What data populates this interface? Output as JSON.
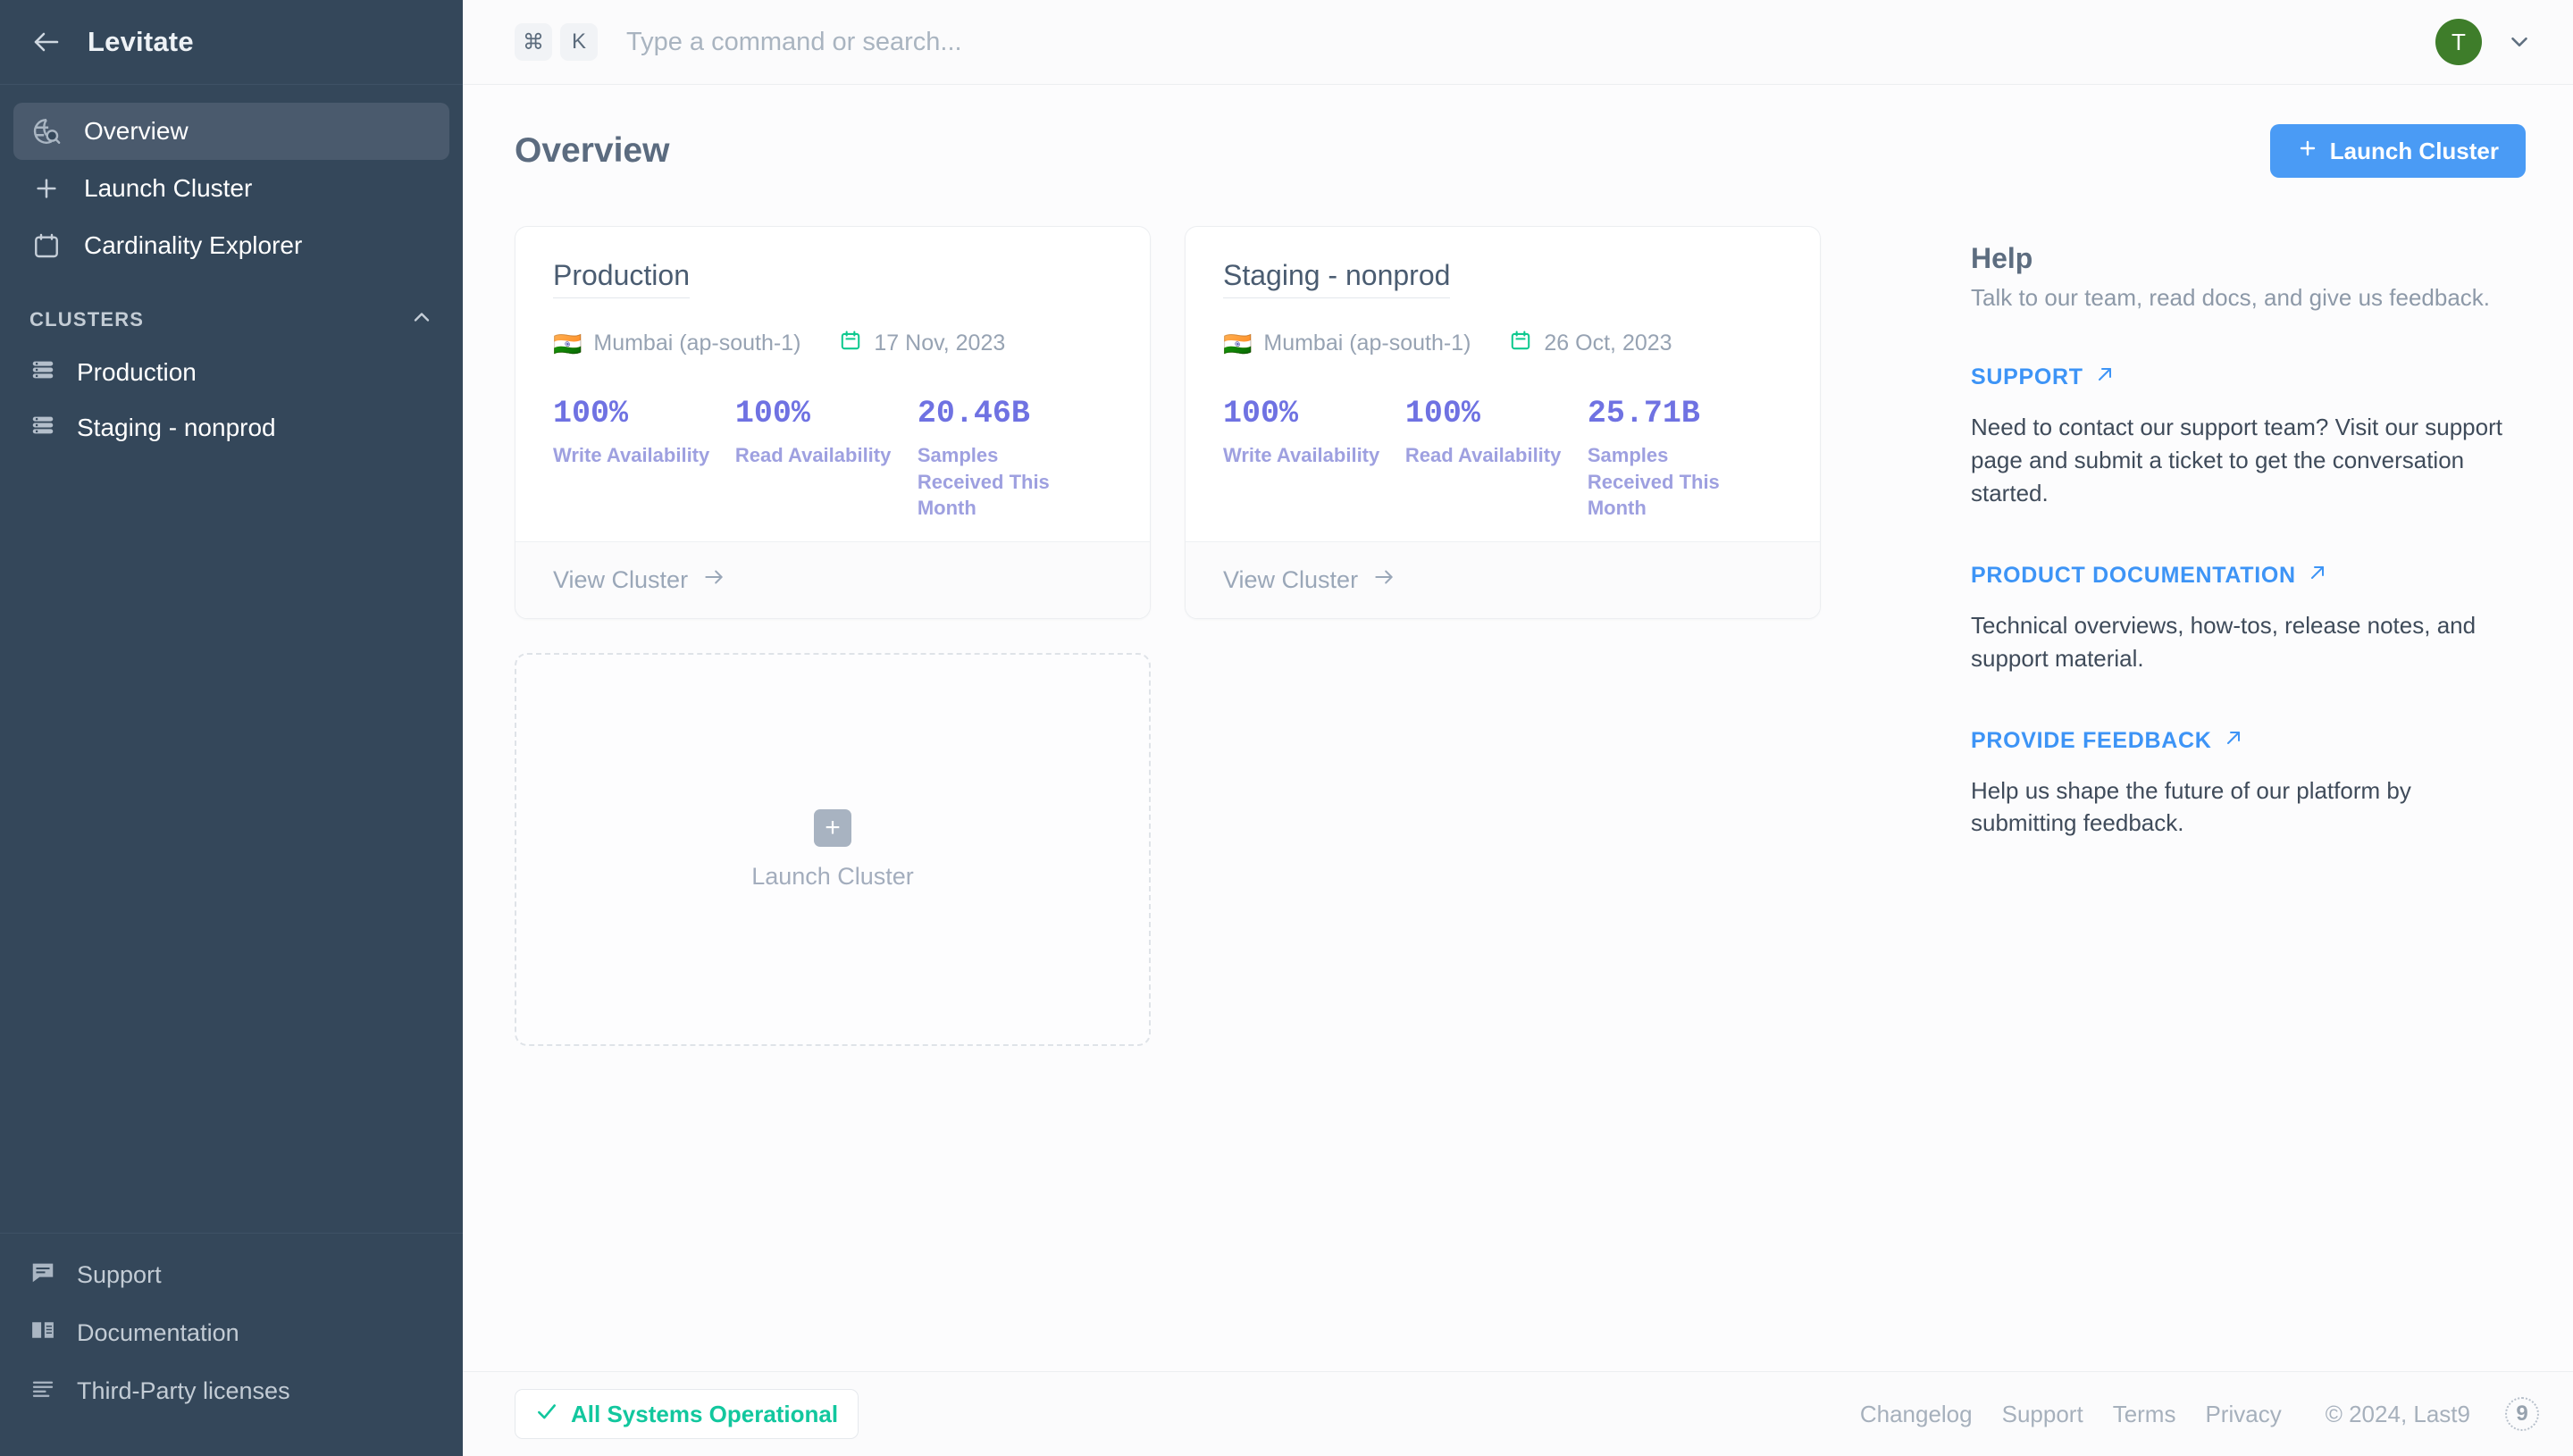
{
  "sidebar": {
    "brand": "Levitate",
    "back_icon": "arrow-left-icon",
    "nav": [
      {
        "label": "Overview",
        "icon": "globe-search-icon",
        "active": true
      },
      {
        "label": "Launch Cluster",
        "icon": "plus-icon",
        "active": false
      },
      {
        "label": "Cardinality Explorer",
        "icon": "calendar-icon",
        "active": false
      }
    ],
    "section": {
      "label": "CLUSTERS",
      "collapse_icon": "chevron-up-icon"
    },
    "clusters": [
      {
        "label": "Production",
        "icon": "server-stack-icon"
      },
      {
        "label": "Staging - nonprod",
        "icon": "server-stack-icon"
      }
    ],
    "footer_items": [
      {
        "label": "Support",
        "icon": "chat-bubble-icon"
      },
      {
        "label": "Documentation",
        "icon": "book-icon"
      },
      {
        "label": "Third-Party licenses",
        "icon": "list-lines-icon"
      }
    ]
  },
  "topbar": {
    "kbd_cmd": "⌘",
    "kbd_key": "K",
    "search_placeholder": "Type a command or search...",
    "search_value": "",
    "avatar_initial": "T",
    "caret_icon": "chevron-down-icon"
  },
  "page": {
    "title": "Overview",
    "launch_button": "Launch Cluster",
    "launch_button_icon": "plus-icon",
    "accent_color": "#4a9bf5"
  },
  "clusters": [
    {
      "name": "Production",
      "flag": "🇮🇳",
      "region": "Mumbai (ap-south-1)",
      "date_icon": "calendar-icon",
      "date": "17 Nov, 2023",
      "stats": [
        {
          "value": "100%",
          "label": "Write Availability"
        },
        {
          "value": "100%",
          "label": "Read Availability"
        },
        {
          "value": "20.46B",
          "label": "Samples Received This Month"
        }
      ],
      "view_link": "View Cluster",
      "view_link_icon": "arrow-right-icon"
    },
    {
      "name": "Staging - nonprod",
      "flag": "🇮🇳",
      "region": "Mumbai (ap-south-1)",
      "date_icon": "calendar-icon",
      "date": "26 Oct, 2023",
      "stats": [
        {
          "value": "100%",
          "label": "Write Availability"
        },
        {
          "value": "100%",
          "label": "Read Availability"
        },
        {
          "value": "25.71B",
          "label": "Samples Received This Month"
        }
      ],
      "view_link": "View Cluster",
      "view_link_icon": "arrow-right-icon"
    }
  ],
  "ghost_card": {
    "label": "Launch Cluster",
    "icon": "plus-icon"
  },
  "help": {
    "title": "Help",
    "subtitle": "Talk to our team, read docs, and give us feedback.",
    "blocks": [
      {
        "link": "SUPPORT",
        "link_icon": "external-link-icon",
        "text": "Need to contact our support team? Visit our support page and submit a ticket to get the conversation started."
      },
      {
        "link": "PRODUCT DOCUMENTATION",
        "link_icon": "external-link-icon",
        "text": "Technical overviews, how-tos, release notes, and support material."
      },
      {
        "link": "PROVIDE FEEDBACK",
        "link_icon": "external-link-icon",
        "text": "Help us shape the future of our platform by submitting feedback."
      }
    ]
  },
  "footer": {
    "status": "All Systems Operational",
    "status_icon": "check-icon",
    "status_color": "#12c79e",
    "links": [
      "Changelog",
      "Support",
      "Terms",
      "Privacy"
    ],
    "copyright": "© 2024, Last9",
    "logo": "9"
  }
}
